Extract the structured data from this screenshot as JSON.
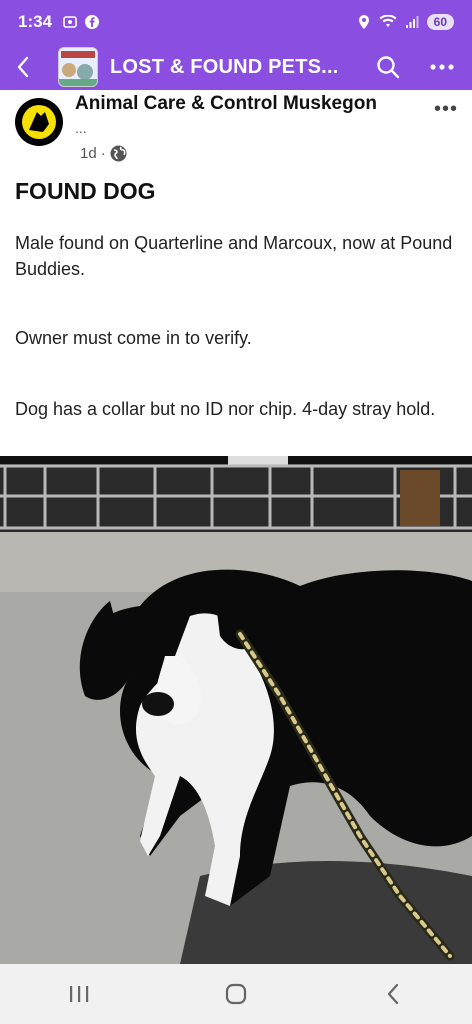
{
  "status": {
    "time": "1:34",
    "battery": "60"
  },
  "appbar": {
    "title": "LOST & FOUND PETS...",
    "thumb_text": "LOST & FOUND"
  },
  "post": {
    "author": "Animal Care & Control Muskegon",
    "author_sub": "...",
    "time": "1d ·",
    "title": "FOUND DOG",
    "paragraphs": [
      "Male found on Quarterline and Marcoux, now at Pound Buddies.",
      "Owner must come in to verify.",
      "Dog has a collar but no ID nor chip. 4-day stray hold."
    ]
  },
  "colors": {
    "header": "#8a4ee0",
    "avatar_accent": "#f5e000"
  },
  "icons": [
    "back-arrow-icon",
    "search-icon",
    "more-options-icon",
    "globe-icon",
    "recents-nav-icon",
    "home-nav-icon",
    "back-nav-icon"
  ]
}
